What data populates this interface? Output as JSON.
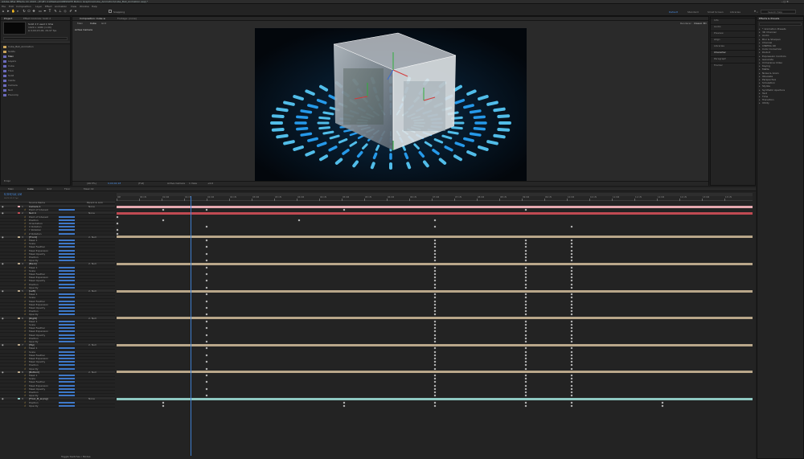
{
  "titlebar": {
    "title": "Adobe After Effects CC 2018 - [E:\\MY C1\\Media\\COMPOSITE Motion Graphics\\Cube_Animation\\Cube_Ball_Animation.aep] *"
  },
  "menu": [
    "File",
    "Edit",
    "Composition",
    "Layer",
    "Effect",
    "Animation",
    "View",
    "Window",
    "Help"
  ],
  "toolbar": {
    "snapping": "Snapping",
    "workspaces": [
      "Default",
      "Standard",
      "Small Screen",
      "Libraries"
    ],
    "active_workspace": "Default",
    "search_placeholder": "Search Help"
  },
  "project": {
    "tabs": [
      "Project",
      "Effect Controls: Solid 2"
    ],
    "selected_info": [
      "Solid 2 ▾ used 1 time",
      "1920 x 1080 (1.00)",
      "Δ 0;00;15;00, 29.97 fps"
    ],
    "items": [
      "Cube_Ball_Animation",
      "Solids",
      "Main",
      "Layers",
      "Cube",
      "Floor",
      "Solid",
      "Inside",
      "Camera",
      "Null",
      "Precomp"
    ],
    "bpc": "8 bpc"
  },
  "composition": {
    "tabs": [
      "Composition: Cube ≡",
      "Footage: (none)"
    ],
    "view_tabs": [
      "Main",
      "Cube",
      "Grid"
    ],
    "label": "Active Camera",
    "footer": {
      "zoom": "(40.5%)",
      "time": "0;00;02;18",
      "quality": "(Full)",
      "camera": "Active Camera",
      "views": "1 View",
      "offset": "+0.0"
    },
    "extra_labels": [
      "Renderer:",
      "Classic 3D"
    ]
  },
  "right_panel": {
    "items": [
      "Info",
      "Audio",
      "Preview",
      "Align",
      "Libraries",
      "Character",
      "Paragraph",
      "Tracker"
    ]
  },
  "effects": {
    "title": "Effects & Presets",
    "search_placeholder": "",
    "items": [
      "* Animation Presets",
      "3D Channel",
      "Audio",
      "Blur & Sharpen",
      "Channel",
      "CINEMA 4D",
      "Color Correction",
      "Distort",
      "Expression Controls",
      "Generate",
      "Immersive Video",
      "Keying",
      "Matte",
      "Noise & Grain",
      "Obsolete",
      "Perspective",
      "Simulation",
      "Stylize",
      "Synthetic Aperture",
      "Text",
      "Time",
      "Transition",
      "Utility"
    ]
  },
  "timeline": {
    "tabs": [
      "Main",
      "Cube",
      "Grid",
      "Floor",
      "Mask 02"
    ],
    "active_tab": "Cube",
    "timecode": "0;00;02;18",
    "fps": "00078 (29.97 fps)",
    "columns": [
      "Source Name",
      "Parent & Link"
    ],
    "ruler": [
      "00f",
      "00:15f",
      "01:00f",
      "01:15f",
      "02:00f",
      "02:15f",
      "03:00f",
      "03:15f",
      "04:00f",
      "04:15f",
      "05:00f",
      "05:15f",
      "06:00f",
      "06:15f",
      "07:00f",
      "07:15f",
      "08:00f",
      "08:15f",
      "09:00f",
      "09:15f",
      "10:00f",
      "10:15f",
      "11:00f",
      "11:15f",
      "12:00f",
      "12:15f",
      "13:00f",
      "13:15f"
    ],
    "layers": [
      {
        "num": "1",
        "name": "Camera 1",
        "parent": "None",
        "color": "#e6a9b0"
      },
      {
        "num": "2",
        "name": "Null 4",
        "parent": "None",
        "color": "#c04a52"
      },
      {
        "num": "3",
        "name": "[Front]",
        "parent": "2. Null",
        "color": "#b9a78a"
      },
      {
        "num": "4",
        "name": "[Back]",
        "parent": "2. Null",
        "color": "#b9a78a"
      },
      {
        "num": "5",
        "name": "[Left]",
        "parent": "2. Null",
        "color": "#b9a78a"
      },
      {
        "num": "6",
        "name": "[Right]",
        "parent": "2. Null",
        "color": "#b9a78a"
      },
      {
        "num": "7",
        "name": "[Top]",
        "parent": "2. Null",
        "color": "#b9a78a"
      },
      {
        "num": "8",
        "name": "[Bottom]",
        "parent": "2. Null",
        "color": "#b9a78a"
      },
      {
        "num": "9",
        "name": "[Floor_B_w.png]",
        "parent": "None",
        "color": "#8fc8c2"
      }
    ],
    "props_cam": [
      "Point of Interest",
      "Position",
      "Orientation",
      "X Rotation",
      "Y Rotation",
      "Z Rotation"
    ],
    "props_face": [
      "Mask 1",
      "Scale",
      "Mask Feather",
      "Mask Expansion",
      "Mask Opacity",
      "Position",
      "Opacity"
    ],
    "footer": "Toggle Switches / Modes"
  }
}
